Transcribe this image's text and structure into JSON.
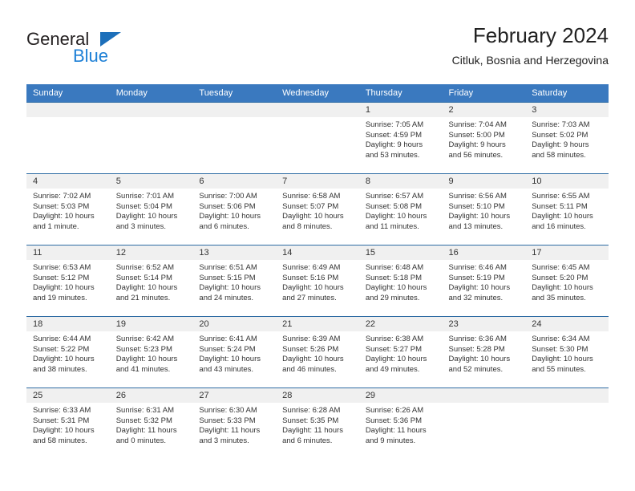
{
  "logo": {
    "word1": "General",
    "word2": "Blue",
    "triangle_color": "#1c6fba",
    "word1_color": "#231f20",
    "word2_color": "#1c7fd6"
  },
  "header": {
    "title": "February 2024",
    "subtitle": "Citluk, Bosnia and Herzegovina"
  },
  "colors": {
    "header_row_bg": "#3a79bf",
    "header_row_text": "#ffffff",
    "day_band_bg": "#f0f0f0",
    "row_border": "#2e6ca4"
  },
  "weekdays": [
    "Sunday",
    "Monday",
    "Tuesday",
    "Wednesday",
    "Thursday",
    "Friday",
    "Saturday"
  ],
  "weeks": [
    [
      {
        "day": "",
        "empty": true,
        "sunrise": "",
        "sunset": "",
        "daylight_line1": "",
        "daylight_line2": ""
      },
      {
        "day": "",
        "empty": true,
        "sunrise": "",
        "sunset": "",
        "daylight_line1": "",
        "daylight_line2": ""
      },
      {
        "day": "",
        "empty": true,
        "sunrise": "",
        "sunset": "",
        "daylight_line1": "",
        "daylight_line2": ""
      },
      {
        "day": "",
        "empty": true,
        "sunrise": "",
        "sunset": "",
        "daylight_line1": "",
        "daylight_line2": ""
      },
      {
        "day": "1",
        "empty": false,
        "sunrise": "Sunrise: 7:05 AM",
        "sunset": "Sunset: 4:59 PM",
        "daylight_line1": "Daylight: 9 hours",
        "daylight_line2": "and 53 minutes."
      },
      {
        "day": "2",
        "empty": false,
        "sunrise": "Sunrise: 7:04 AM",
        "sunset": "Sunset: 5:00 PM",
        "daylight_line1": "Daylight: 9 hours",
        "daylight_line2": "and 56 minutes."
      },
      {
        "day": "3",
        "empty": false,
        "sunrise": "Sunrise: 7:03 AM",
        "sunset": "Sunset: 5:02 PM",
        "daylight_line1": "Daylight: 9 hours",
        "daylight_line2": "and 58 minutes."
      }
    ],
    [
      {
        "day": "4",
        "empty": false,
        "sunrise": "Sunrise: 7:02 AM",
        "sunset": "Sunset: 5:03 PM",
        "daylight_line1": "Daylight: 10 hours",
        "daylight_line2": "and 1 minute."
      },
      {
        "day": "5",
        "empty": false,
        "sunrise": "Sunrise: 7:01 AM",
        "sunset": "Sunset: 5:04 PM",
        "daylight_line1": "Daylight: 10 hours",
        "daylight_line2": "and 3 minutes."
      },
      {
        "day": "6",
        "empty": false,
        "sunrise": "Sunrise: 7:00 AM",
        "sunset": "Sunset: 5:06 PM",
        "daylight_line1": "Daylight: 10 hours",
        "daylight_line2": "and 6 minutes."
      },
      {
        "day": "7",
        "empty": false,
        "sunrise": "Sunrise: 6:58 AM",
        "sunset": "Sunset: 5:07 PM",
        "daylight_line1": "Daylight: 10 hours",
        "daylight_line2": "and 8 minutes."
      },
      {
        "day": "8",
        "empty": false,
        "sunrise": "Sunrise: 6:57 AM",
        "sunset": "Sunset: 5:08 PM",
        "daylight_line1": "Daylight: 10 hours",
        "daylight_line2": "and 11 minutes."
      },
      {
        "day": "9",
        "empty": false,
        "sunrise": "Sunrise: 6:56 AM",
        "sunset": "Sunset: 5:10 PM",
        "daylight_line1": "Daylight: 10 hours",
        "daylight_line2": "and 13 minutes."
      },
      {
        "day": "10",
        "empty": false,
        "sunrise": "Sunrise: 6:55 AM",
        "sunset": "Sunset: 5:11 PM",
        "daylight_line1": "Daylight: 10 hours",
        "daylight_line2": "and 16 minutes."
      }
    ],
    [
      {
        "day": "11",
        "empty": false,
        "sunrise": "Sunrise: 6:53 AM",
        "sunset": "Sunset: 5:12 PM",
        "daylight_line1": "Daylight: 10 hours",
        "daylight_line2": "and 19 minutes."
      },
      {
        "day": "12",
        "empty": false,
        "sunrise": "Sunrise: 6:52 AM",
        "sunset": "Sunset: 5:14 PM",
        "daylight_line1": "Daylight: 10 hours",
        "daylight_line2": "and 21 minutes."
      },
      {
        "day": "13",
        "empty": false,
        "sunrise": "Sunrise: 6:51 AM",
        "sunset": "Sunset: 5:15 PM",
        "daylight_line1": "Daylight: 10 hours",
        "daylight_line2": "and 24 minutes."
      },
      {
        "day": "14",
        "empty": false,
        "sunrise": "Sunrise: 6:49 AM",
        "sunset": "Sunset: 5:16 PM",
        "daylight_line1": "Daylight: 10 hours",
        "daylight_line2": "and 27 minutes."
      },
      {
        "day": "15",
        "empty": false,
        "sunrise": "Sunrise: 6:48 AM",
        "sunset": "Sunset: 5:18 PM",
        "daylight_line1": "Daylight: 10 hours",
        "daylight_line2": "and 29 minutes."
      },
      {
        "day": "16",
        "empty": false,
        "sunrise": "Sunrise: 6:46 AM",
        "sunset": "Sunset: 5:19 PM",
        "daylight_line1": "Daylight: 10 hours",
        "daylight_line2": "and 32 minutes."
      },
      {
        "day": "17",
        "empty": false,
        "sunrise": "Sunrise: 6:45 AM",
        "sunset": "Sunset: 5:20 PM",
        "daylight_line1": "Daylight: 10 hours",
        "daylight_line2": "and 35 minutes."
      }
    ],
    [
      {
        "day": "18",
        "empty": false,
        "sunrise": "Sunrise: 6:44 AM",
        "sunset": "Sunset: 5:22 PM",
        "daylight_line1": "Daylight: 10 hours",
        "daylight_line2": "and 38 minutes."
      },
      {
        "day": "19",
        "empty": false,
        "sunrise": "Sunrise: 6:42 AM",
        "sunset": "Sunset: 5:23 PM",
        "daylight_line1": "Daylight: 10 hours",
        "daylight_line2": "and 41 minutes."
      },
      {
        "day": "20",
        "empty": false,
        "sunrise": "Sunrise: 6:41 AM",
        "sunset": "Sunset: 5:24 PM",
        "daylight_line1": "Daylight: 10 hours",
        "daylight_line2": "and 43 minutes."
      },
      {
        "day": "21",
        "empty": false,
        "sunrise": "Sunrise: 6:39 AM",
        "sunset": "Sunset: 5:26 PM",
        "daylight_line1": "Daylight: 10 hours",
        "daylight_line2": "and 46 minutes."
      },
      {
        "day": "22",
        "empty": false,
        "sunrise": "Sunrise: 6:38 AM",
        "sunset": "Sunset: 5:27 PM",
        "daylight_line1": "Daylight: 10 hours",
        "daylight_line2": "and 49 minutes."
      },
      {
        "day": "23",
        "empty": false,
        "sunrise": "Sunrise: 6:36 AM",
        "sunset": "Sunset: 5:28 PM",
        "daylight_line1": "Daylight: 10 hours",
        "daylight_line2": "and 52 minutes."
      },
      {
        "day": "24",
        "empty": false,
        "sunrise": "Sunrise: 6:34 AM",
        "sunset": "Sunset: 5:30 PM",
        "daylight_line1": "Daylight: 10 hours",
        "daylight_line2": "and 55 minutes."
      }
    ],
    [
      {
        "day": "25",
        "empty": false,
        "sunrise": "Sunrise: 6:33 AM",
        "sunset": "Sunset: 5:31 PM",
        "daylight_line1": "Daylight: 10 hours",
        "daylight_line2": "and 58 minutes."
      },
      {
        "day": "26",
        "empty": false,
        "sunrise": "Sunrise: 6:31 AM",
        "sunset": "Sunset: 5:32 PM",
        "daylight_line1": "Daylight: 11 hours",
        "daylight_line2": "and 0 minutes."
      },
      {
        "day": "27",
        "empty": false,
        "sunrise": "Sunrise: 6:30 AM",
        "sunset": "Sunset: 5:33 PM",
        "daylight_line1": "Daylight: 11 hours",
        "daylight_line2": "and 3 minutes."
      },
      {
        "day": "28",
        "empty": false,
        "sunrise": "Sunrise: 6:28 AM",
        "sunset": "Sunset: 5:35 PM",
        "daylight_line1": "Daylight: 11 hours",
        "daylight_line2": "and 6 minutes."
      },
      {
        "day": "29",
        "empty": false,
        "sunrise": "Sunrise: 6:26 AM",
        "sunset": "Sunset: 5:36 PM",
        "daylight_line1": "Daylight: 11 hours",
        "daylight_line2": "and 9 minutes."
      },
      {
        "day": "",
        "empty": true,
        "sunrise": "",
        "sunset": "",
        "daylight_line1": "",
        "daylight_line2": ""
      },
      {
        "day": "",
        "empty": true,
        "sunrise": "",
        "sunset": "",
        "daylight_line1": "",
        "daylight_line2": ""
      }
    ]
  ]
}
